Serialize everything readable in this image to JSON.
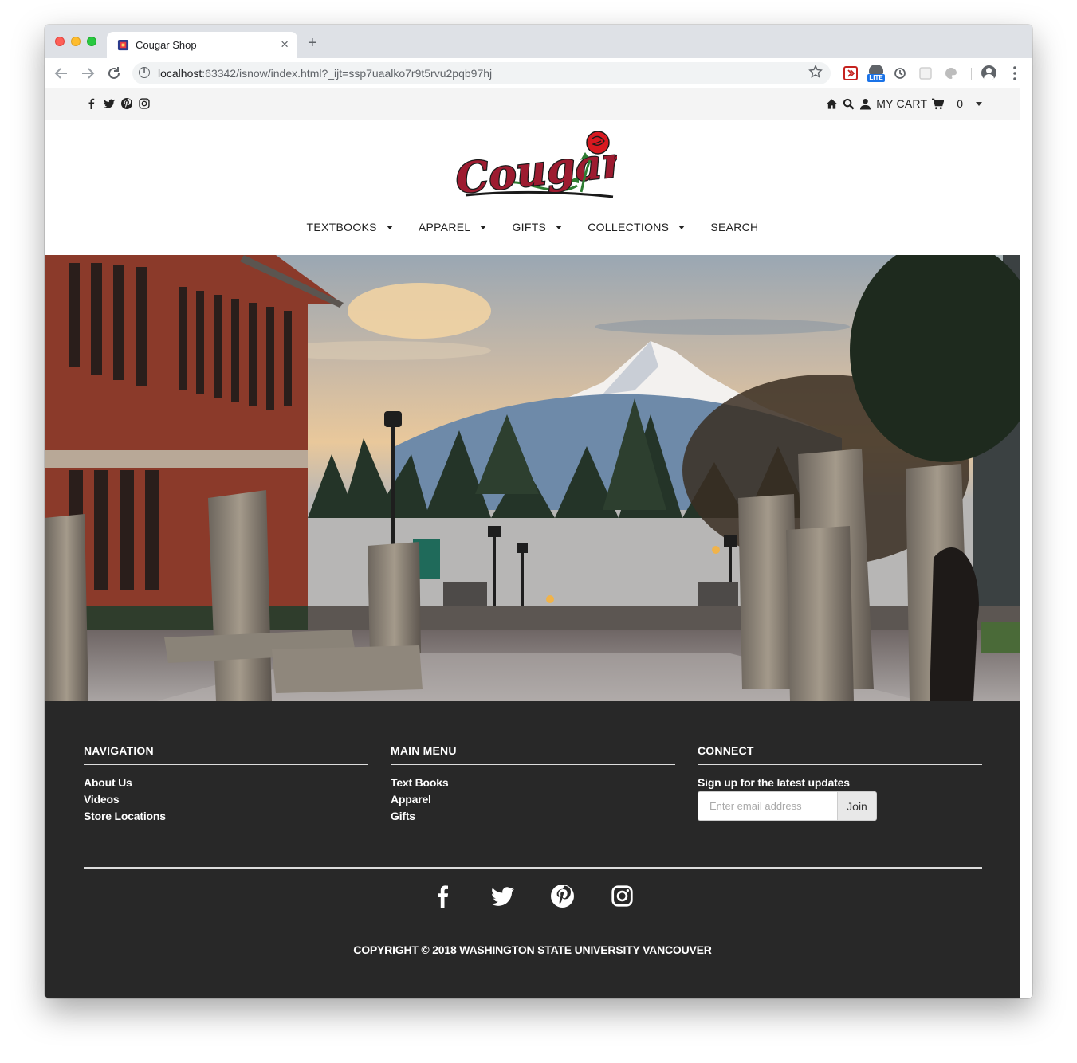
{
  "browser": {
    "tab_title": "Cougar Shop",
    "url_host": "localhost",
    "url_rest": ":63342/isnow/index.html?_ijt=ssp7uaalko7r9t5rvu2pqb97hj",
    "ext_lite_badge": "LITE",
    "icons": [
      "back-arrow-icon",
      "forward-arrow-icon",
      "reload-icon",
      "info-icon",
      "star-icon",
      "profile-icon",
      "menu-dots-icon"
    ]
  },
  "topbar": {
    "social_icons": [
      "facebook-icon",
      "twitter-icon",
      "pinterest-icon",
      "instagram-icon"
    ],
    "cart_label": "MY CART",
    "cart_count": "0"
  },
  "header": {
    "logo_text": "Cougars"
  },
  "nav": {
    "items": [
      {
        "label": "TEXTBOOKS",
        "has_dropdown": true
      },
      {
        "label": "APPAREL",
        "has_dropdown": true
      },
      {
        "label": "GIFTS",
        "has_dropdown": true
      },
      {
        "label": "COLLECTIONS",
        "has_dropdown": true
      },
      {
        "label": "SEARCH",
        "has_dropdown": false
      }
    ]
  },
  "footer": {
    "navigation": {
      "title": "NAVIGATION",
      "links": [
        "About Us",
        "Videos",
        "Store Locations"
      ]
    },
    "main_menu": {
      "title": "MAIN MENU",
      "links": [
        "Text Books",
        "Apparel",
        "Gifts"
      ]
    },
    "connect": {
      "title": "CONNECT",
      "text": "Sign up for the latest updates",
      "email_placeholder": "Enter email address",
      "join_label": "Join"
    },
    "social_icons": [
      "facebook-icon",
      "twitter-icon",
      "pinterest-icon",
      "instagram-icon"
    ],
    "copyright": "COPYRIGHT © 2018 WASHINGTON STATE UNIVERSITY VANCOUVER"
  },
  "colors": {
    "brand_crimson": "#9d1b30",
    "footer_bg": "#282828",
    "topbar_bg": "#f4f4f4"
  }
}
